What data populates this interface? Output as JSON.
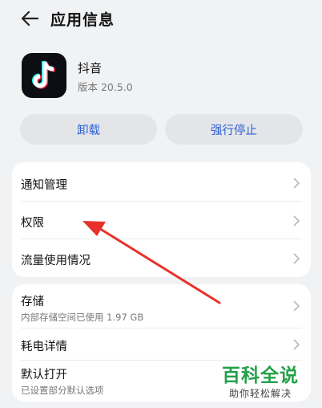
{
  "header": {
    "title": "应用信息",
    "back_icon": "back-arrow-icon"
  },
  "app": {
    "name": "抖音",
    "version": "版本 20.5.0",
    "icon": "tiktok-logo-icon"
  },
  "actions": {
    "uninstall": "卸载",
    "force_stop": "强行停止",
    "accent": "#2a5fd6"
  },
  "group1": [
    {
      "label": "通知管理"
    },
    {
      "label": "权限"
    },
    {
      "label": "流量使用情况"
    }
  ],
  "group2": [
    {
      "label": "存储",
      "sub": "内部存储空间已使用 1.97 GB"
    },
    {
      "label": "耗电详情"
    },
    {
      "label": "默认打开",
      "sub": "已设置部分默认选项"
    }
  ],
  "watermark": {
    "title": "百科全说",
    "subtitle": "助你轻松解决"
  }
}
